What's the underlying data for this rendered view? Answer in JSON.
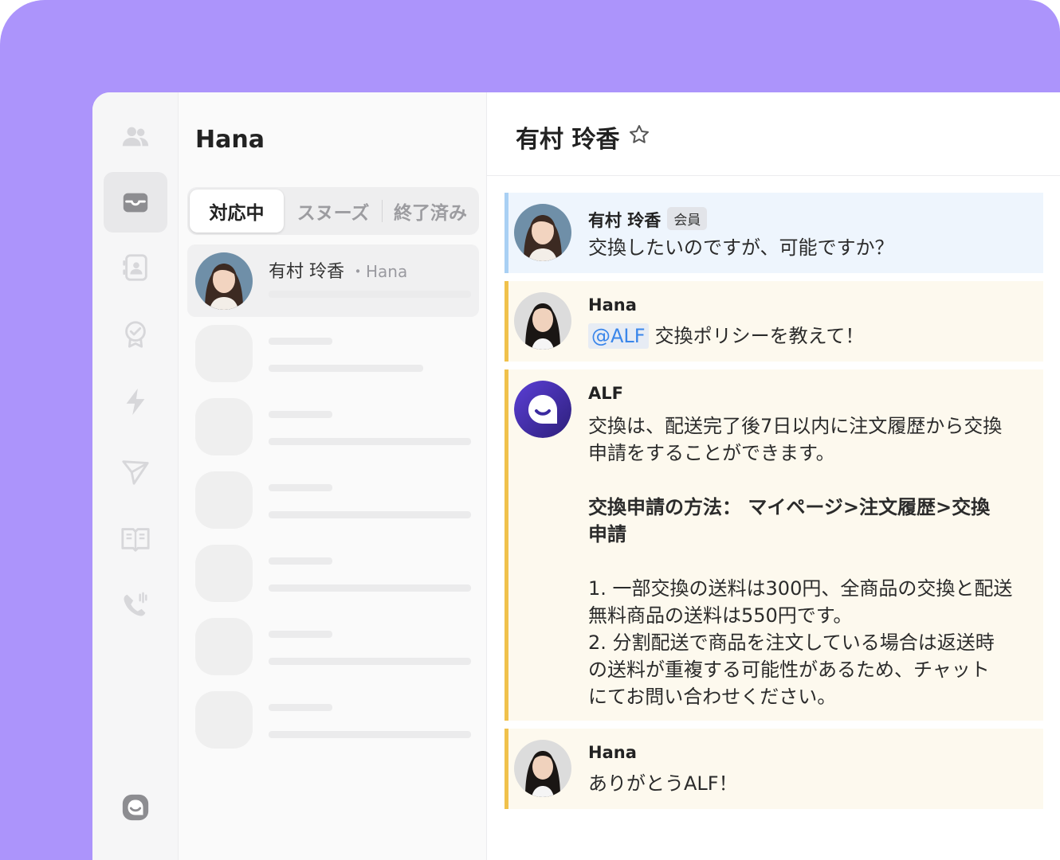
{
  "colors": {
    "background_purple": "#ac94fb",
    "customer_bar": "#a9d0f4",
    "customer_bg": "#eef5fd",
    "agent_bar": "#f0c14b",
    "agent_bg": "#fdf9ee",
    "mention_text": "#3a86ea"
  },
  "rail": {
    "icons": [
      "people-icon",
      "inbox-icon",
      "contact-card-icon",
      "badge-check-icon",
      "lightning-icon",
      "send-icon",
      "book-icon",
      "phone-icon",
      "app-logo-icon"
    ],
    "active": "inbox-icon"
  },
  "list": {
    "title": "Hana",
    "tabs": [
      "対応中",
      "スヌーズ",
      "終了済み"
    ],
    "active_tab": "対応中",
    "conversation": {
      "name": "有村 玲香",
      "assignee": "・Hana"
    }
  },
  "chat": {
    "title": "有村 玲香",
    "messages": [
      {
        "sender": "有村 玲香",
        "badge": "会員",
        "text": "交換したいのですが、可能ですか？"
      },
      {
        "sender": "Hana",
        "mention": "@ALF",
        "text": "交換ポリシーを教えて！"
      },
      {
        "sender": "ALF",
        "lines": [
          "交換は、配送完了後7日以内に注文履歴から交換",
          "申請をすることができます。",
          "交換申請の方法： マイページ>注文履歴>交換",
          "申請",
          "1. 一部交換の送料は300円、全商品の交換と配送",
          "無料商品の送料は550円です。",
          "2. 分割配送で商品を注文している場合は返送時",
          "の送料が重複する可能性があるため、チャット",
          "にてお問い合わせください。"
        ]
      },
      {
        "sender": "Hana",
        "text": "ありがとうALF！"
      }
    ]
  }
}
